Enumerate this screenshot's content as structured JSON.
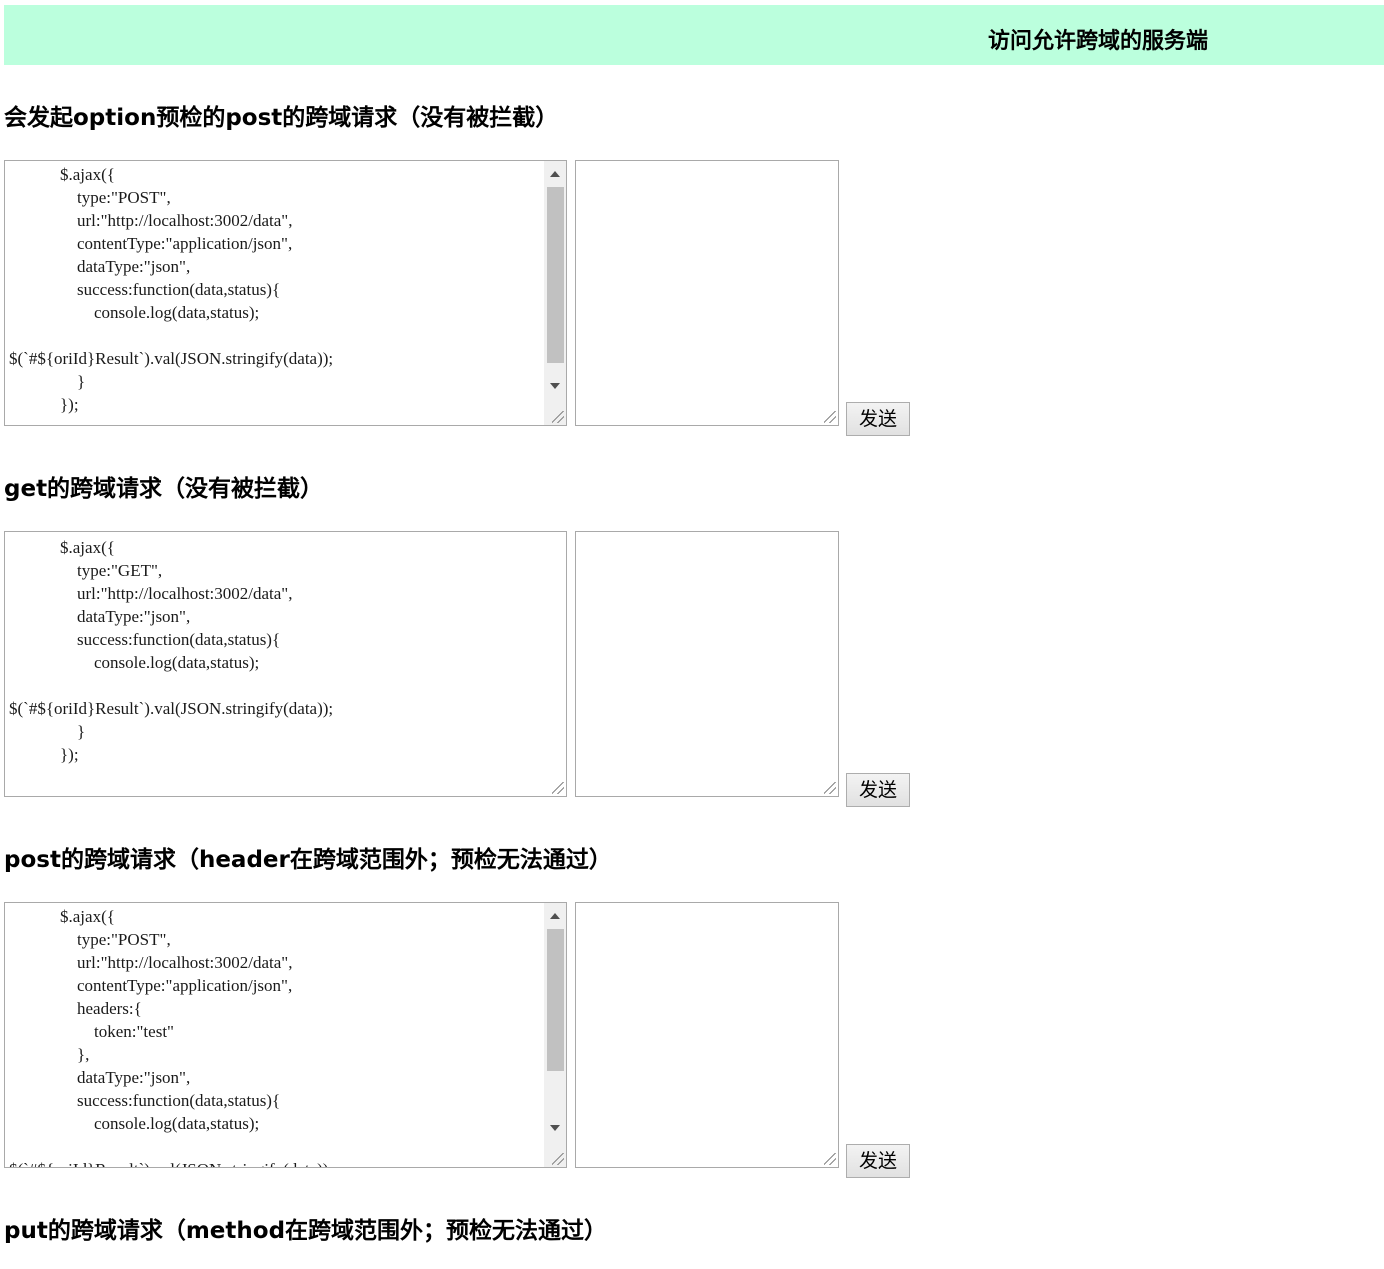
{
  "header": {
    "title": "访问允许跨域的服务端"
  },
  "sections": [
    {
      "title": "会发起option预检的post的跨域请求（没有被拦截）",
      "code": "            $.ajax({\n                type:\"POST\",\n                url:\"http://localhost:3002/data\",\n                contentType:\"application/json\",\n                dataType:\"json\",\n                success:function(data,status){\n                    console.log(data,status);\n\n$(`#${oriId}Result`).val(JSON.stringify(data));\n                }\n            });",
      "result": "",
      "button": "发送"
    },
    {
      "title": "get的跨域请求（没有被拦截）",
      "code": "            $.ajax({\n                type:\"GET\",\n                url:\"http://localhost:3002/data\",\n                dataType:\"json\",\n                success:function(data,status){\n                    console.log(data,status);\n\n$(`#${oriId}Result`).val(JSON.stringify(data));\n                }\n            });",
      "result": "",
      "button": "发送"
    },
    {
      "title": "post的跨域请求（header在跨域范围外；预检无法通过）",
      "code": "            $.ajax({\n                type:\"POST\",\n                url:\"http://localhost:3002/data\",\n                contentType:\"application/json\",\n                headers:{\n                    token:\"test\"\n                },\n                dataType:\"json\",\n                success:function(data,status){\n                    console.log(data,status);\n\n$(`#${oriId}Result`).val(JSON.stringify(data));",
      "result": "",
      "button": "发送"
    },
    {
      "title": "put的跨域请求（method在跨域范围外；预检无法通过）"
    }
  ]
}
